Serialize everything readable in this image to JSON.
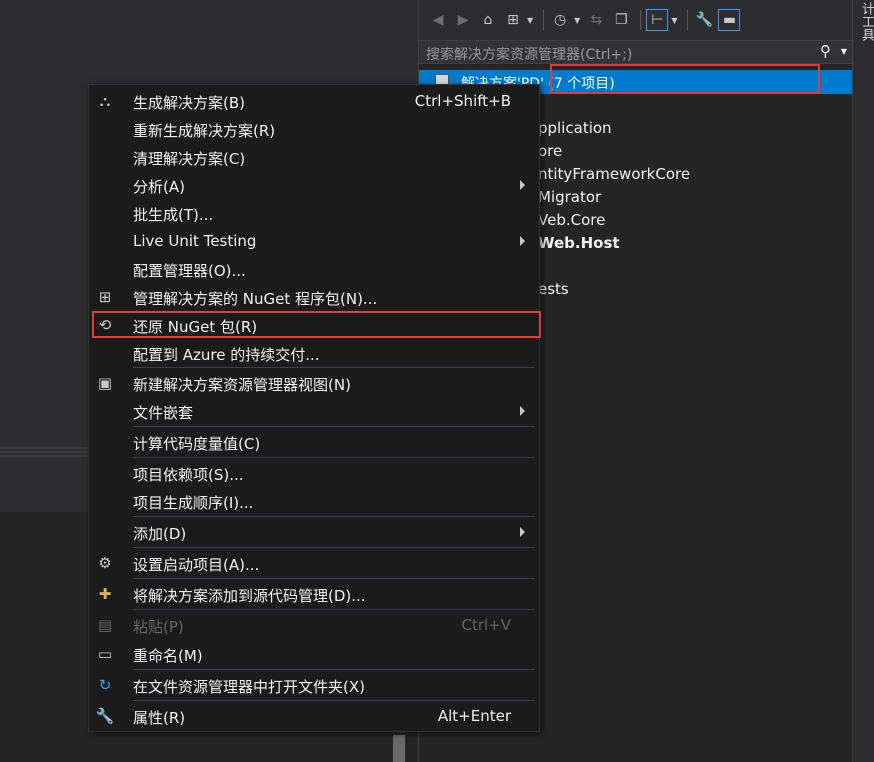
{
  "search": {
    "placeholder": "搜索解决方案资源管理器(Ctrl+;)"
  },
  "solution": {
    "name": "解决方案'PD'",
    "count": "(7 个项目)"
  },
  "tree": [
    "Application",
    "Core",
    "EntityFrameworkCore",
    "Migrator",
    "Web.Core",
    "Web.Host",
    "Tests"
  ],
  "tree_visible": [
    "pplication",
    "ore",
    "ntityFrameworkCore",
    "Migrator",
    "Veb.Core",
    "Web.Host",
    "ests"
  ],
  "side_tab": "计工具",
  "menu": {
    "items": [
      {
        "label": "生成解决方案(B)",
        "shortcut": "Ctrl+Shift+B",
        "icon": "build-icon"
      },
      {
        "label": "重新生成解决方案(R)"
      },
      {
        "label": "清理解决方案(C)"
      },
      {
        "label": "分析(A)",
        "submenu": true
      },
      {
        "label": "批生成(T)..."
      },
      {
        "label": "Live Unit Testing",
        "submenu": true
      },
      {
        "label": "配置管理器(O)..."
      },
      {
        "label": "管理解决方案的 NuGet 程序包(N)...",
        "icon": "nuget-package-icon"
      },
      {
        "label": "还原 NuGet 包(R)",
        "icon": "restore-package-icon"
      },
      {
        "label": "配置到 Azure 的持续交付..."
      },
      {
        "label": "新建解决方案资源管理器视图(N)",
        "icon": "new-view-icon"
      },
      {
        "label": "文件嵌套",
        "submenu": true
      },
      {
        "label": "计算代码度量值(C)"
      },
      {
        "label": "项目依赖项(S)..."
      },
      {
        "label": "项目生成顺序(I)..."
      },
      {
        "label": "添加(D)",
        "submenu": true
      },
      {
        "label": "设置启动项目(A)...",
        "icon": "gear-icon"
      },
      {
        "label": "将解决方案添加到源代码管理(D)...",
        "icon": "source-control-icon"
      },
      {
        "label": "粘贴(P)",
        "shortcut": "Ctrl+V",
        "icon": "paste-icon",
        "disabled": true
      },
      {
        "label": "重命名(M)",
        "icon": "rename-icon"
      },
      {
        "label": "在文件资源管理器中打开文件夹(X)",
        "icon": "open-folder-icon"
      },
      {
        "label": "属性(R)",
        "shortcut": "Alt+Enter",
        "icon": "wrench-icon"
      }
    ]
  },
  "colors": {
    "accent": "#007acc",
    "highlight_box": "#e03c3c",
    "menu_bg": "#1b1b1c"
  }
}
